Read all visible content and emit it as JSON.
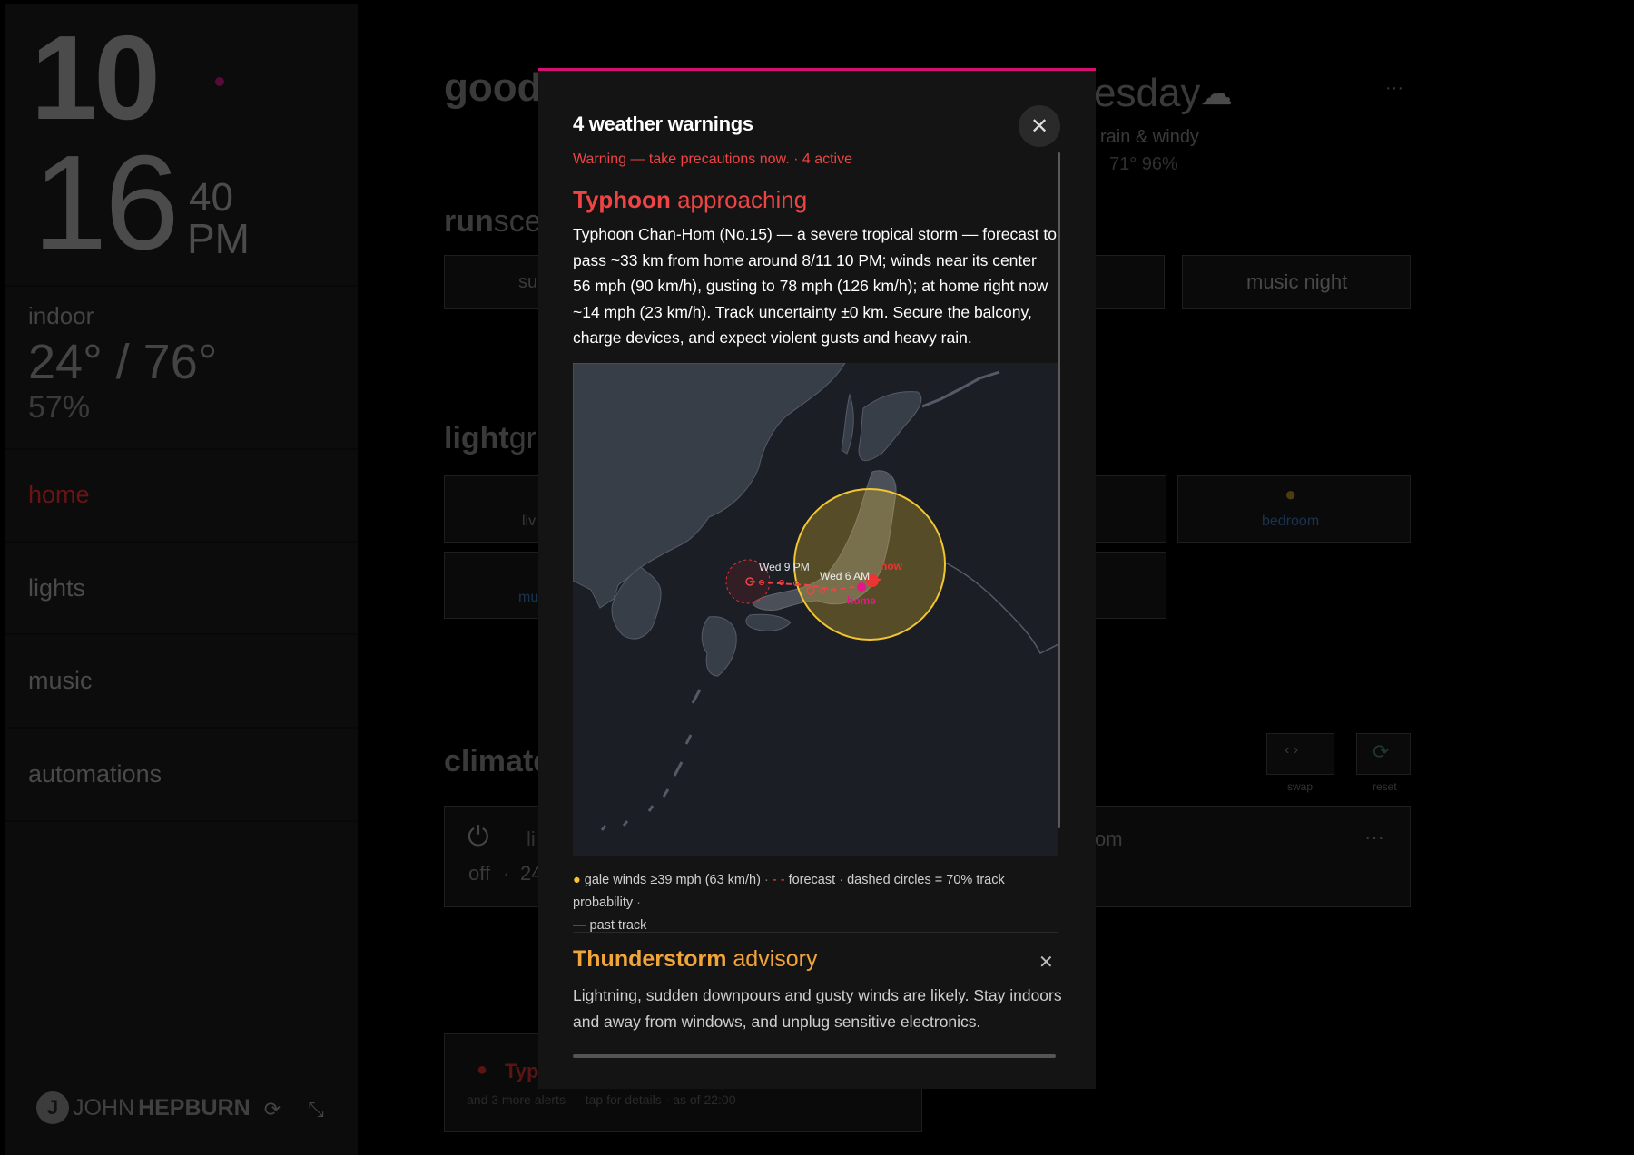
{
  "sidebar": {
    "clock": {
      "hour": "10",
      "minute": "16",
      "second": "40",
      "ampm": "PM"
    },
    "indoor": {
      "label": "indoor",
      "temp": "24° / 76°",
      "humidity": "57%"
    },
    "nav": [
      {
        "label": "home",
        "active": true
      },
      {
        "label": "lights",
        "active": false
      },
      {
        "label": "music",
        "active": false
      },
      {
        "label": "automations",
        "active": false
      }
    ],
    "brand": {
      "light": "JOHN",
      "bold": "HEPBURN"
    }
  },
  "background": {
    "greeting": "good",
    "weather_day": "esday",
    "weather_desc": "rain & windy",
    "weather_stats": "71° 96%",
    "scenes_heading_bold": "run",
    "scenes_heading_light": "sce",
    "scene_partial": "su",
    "scene_music_night": "music night",
    "lights_heading_bold": "light",
    "lights_heading_light": "gr",
    "light_partial_1": "liv",
    "light_partial_2": "mu",
    "light_bedroom": "bedroom",
    "climate_heading": "climate",
    "swap_label": "swap",
    "reset_label": "reset",
    "climate_state": "off",
    "climate_temp_partial": "24",
    "climate_partial_label": "li",
    "climate_room_partial": "om",
    "alert_title_partial": "Typ",
    "alert_footer": "and 3 more alerts — tap for details · as of 22:00"
  },
  "modal": {
    "title": "4 weather warnings",
    "subheading": "Warning — take precautions now.  ·  4 active",
    "typhoon": {
      "title_bold": "Typhoon",
      "title_light": "approaching",
      "description": "Typhoon Chan-Hom (No.15) — a severe tropical storm — forecast to pass ~33 km from home around 8/11 10 PM; winds near its center 56 mph (90 km/h), gusting to 78 mph (126 km/h); at home right now ~14 mph (23 km/h). Track uncertainty ±0 km. Secure the balcony, charge devices, and expect violent gusts and heavy rain.",
      "map_labels": {
        "wed9pm": "Wed 9 PM",
        "wed6am": "Wed 6 AM",
        "now": "now",
        "home": "home"
      },
      "legend": {
        "gale": "gale winds ≥39 mph (63 km/h)",
        "forecast": "forecast",
        "circles": "dashed circles = 70% track probability",
        "past": "past track"
      }
    },
    "thunderstorm": {
      "title_bold": "Thunderstorm",
      "title_light": "advisory",
      "description": "Lightning, sudden downpours and gusty winds are likely. Stay indoors and away from windows, and unplug sensitive electronics."
    }
  },
  "colors": {
    "accent": "#d4116e",
    "warning_red": "#ee4444",
    "advisory_orange": "#f0a43a",
    "gale_yellow": "#f2c531"
  }
}
